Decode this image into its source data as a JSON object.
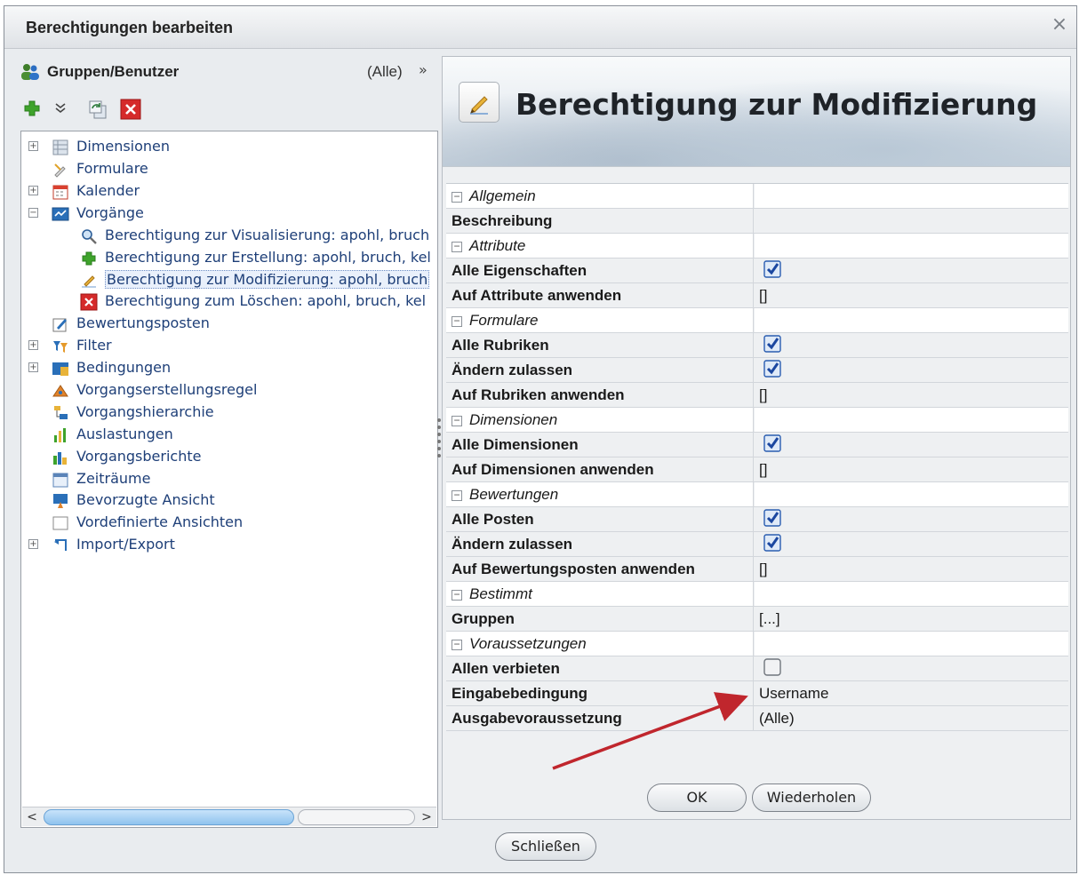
{
  "dialog": {
    "title": "Berechtigungen bearbeiten",
    "close_glyph": "×"
  },
  "left": {
    "header_title": "Gruppen/Benutzer",
    "filter_value": "(Alle)",
    "filter_glyph": "»",
    "toolbar": [
      {
        "name": "add-icon"
      },
      {
        "name": "dropdown-chevron-icon"
      },
      {
        "name": "refresh-icon"
      },
      {
        "name": "delete-icon"
      }
    ],
    "tree": [
      {
        "label": "Dimensionen",
        "expander": "+",
        "icon": "dimensions-icon",
        "level": 0
      },
      {
        "label": "Formulare",
        "expander": "",
        "icon": "forms-icon",
        "level": 0
      },
      {
        "label": "Kalender",
        "expander": "+",
        "icon": "calendar-icon",
        "level": 0
      },
      {
        "label": "Vorgänge",
        "expander": "−",
        "icon": "processes-icon",
        "level": 0
      },
      {
        "label": "Berechtigung zur Visualisierung: apohl, bruch",
        "expander": "",
        "icon": "magnifier-icon",
        "level": 1
      },
      {
        "label": "Berechtigung zur Erstellung: apohl, bruch, kel",
        "expander": "",
        "icon": "plus-icon",
        "level": 1
      },
      {
        "label": "Berechtigung zur Modifizierung: apohl, bruch",
        "expander": "",
        "icon": "edit-icon",
        "level": 1,
        "selected": true
      },
      {
        "label": "Berechtigung zum Löschen: apohl, bruch, kel",
        "expander": "",
        "icon": "delete-icon",
        "level": 1
      },
      {
        "label": "Bewertungsposten",
        "expander": "",
        "icon": "rating-icon",
        "level": 0
      },
      {
        "label": "Filter",
        "expander": "+",
        "icon": "filter-icon",
        "level": 0
      },
      {
        "label": "Bedingungen",
        "expander": "+",
        "icon": "conditions-icon",
        "level": 0
      },
      {
        "label": "Vorgangserstellungsregel",
        "expander": "",
        "icon": "rule-icon",
        "level": 0
      },
      {
        "label": "Vorgangshierarchie",
        "expander": "",
        "icon": "hierarchy-icon",
        "level": 0
      },
      {
        "label": "Auslastungen",
        "expander": "",
        "icon": "workload-icon",
        "level": 0
      },
      {
        "label": "Vorgangsberichte",
        "expander": "",
        "icon": "reports-icon",
        "level": 0
      },
      {
        "label": "Zeiträume",
        "expander": "",
        "icon": "periods-icon",
        "level": 0
      },
      {
        "label": "Bevorzugte Ansicht",
        "expander": "",
        "icon": "preferred-view-icon",
        "level": 0
      },
      {
        "label": "Vordefinierte Ansichten",
        "expander": "",
        "icon": "predefined-views-icon",
        "level": 0
      },
      {
        "label": "Import/Export",
        "expander": "+",
        "icon": "import-export-icon",
        "level": 0
      }
    ],
    "scroll_left": "<",
    "scroll_right": ">"
  },
  "right": {
    "banner_title": "Berechtigung zur Modifizierung",
    "properties": [
      {
        "type": "cat",
        "key": "Allgemein"
      },
      {
        "type": "prop",
        "key": "Beschreibung",
        "value": ""
      },
      {
        "type": "cat",
        "key": "Attribute"
      },
      {
        "type": "prop",
        "key": "Alle Eigenschaften",
        "checkbox": true
      },
      {
        "type": "prop",
        "key": "Auf Attribute anwenden",
        "value": "[]"
      },
      {
        "type": "cat",
        "key": "Formulare"
      },
      {
        "type": "prop",
        "key": "Alle Rubriken",
        "checkbox": true
      },
      {
        "type": "prop",
        "key": "Ändern zulassen",
        "checkbox": true
      },
      {
        "type": "prop",
        "key": "Auf Rubriken anwenden",
        "value": "[]"
      },
      {
        "type": "cat",
        "key": "Dimensionen"
      },
      {
        "type": "prop",
        "key": "Alle Dimensionen",
        "checkbox": true
      },
      {
        "type": "prop",
        "key": "Auf Dimensionen anwenden",
        "value": "[]"
      },
      {
        "type": "cat",
        "key": "Bewertungen"
      },
      {
        "type": "prop",
        "key": "Alle Posten",
        "checkbox": true
      },
      {
        "type": "prop",
        "key": "Ändern zulassen",
        "checkbox": true
      },
      {
        "type": "prop",
        "key": "Auf Bewertungsposten anwenden",
        "value": "[]"
      },
      {
        "type": "cat",
        "key": "Bestimmt"
      },
      {
        "type": "prop",
        "key": "Gruppen",
        "value": "[...]"
      },
      {
        "type": "cat",
        "key": "Voraussetzungen"
      },
      {
        "type": "prop",
        "key": "Allen verbieten",
        "checkbox": false
      },
      {
        "type": "prop",
        "key": "Eingabebedingung",
        "value": "Username"
      },
      {
        "type": "prop",
        "key": "Ausgabevoraussetzung",
        "value": "(Alle)"
      }
    ],
    "ok_label": "OK",
    "repeat_label": "Wiederholen"
  },
  "footer": {
    "close_label": "Schließen"
  },
  "colors": {
    "checkbox_checked": "#2a5db0",
    "annotation_arrow": "#c0262d",
    "tree_text": "#1e3f78"
  }
}
